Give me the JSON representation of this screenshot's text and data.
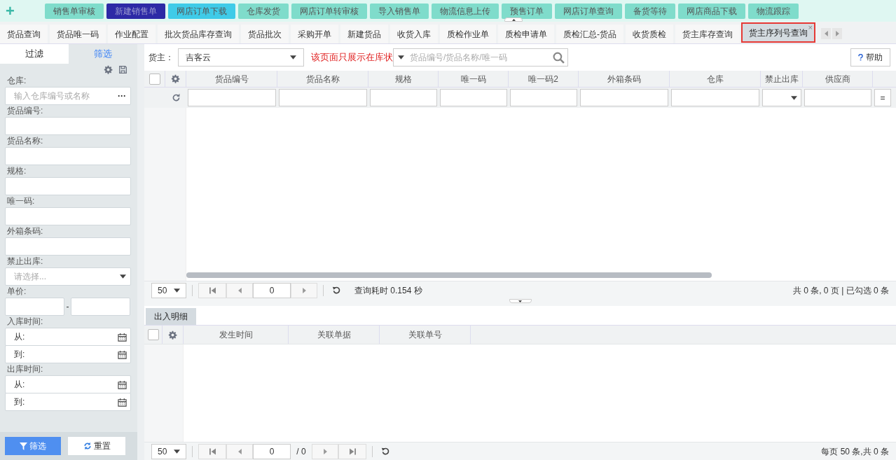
{
  "toolbar": {
    "add_icon": "+",
    "buttons": [
      {
        "label": "销售单审核",
        "color": "#7fdccb"
      },
      {
        "label": "新建销售单",
        "color": "#2d2aa6"
      },
      {
        "label": "网店订单下载",
        "color": "#3fcbe8"
      },
      {
        "label": "仓库发货",
        "color": "#7fdccb"
      },
      {
        "label": "网店订单转审核",
        "color": "#7fdccb"
      },
      {
        "label": "导入销售单",
        "color": "#7fdccb"
      },
      {
        "label": "物流信息上传",
        "color": "#7fdccb"
      },
      {
        "label": "预售订单",
        "color": "#7fdccb"
      },
      {
        "label": "网店订单查询",
        "color": "#7fdccb"
      },
      {
        "label": "备货等待",
        "color": "#7fdccb"
      },
      {
        "label": "网店商品下载",
        "color": "#7fdccb"
      },
      {
        "label": "物流跟踪",
        "color": "#7fdccb"
      }
    ]
  },
  "tabs": [
    {
      "label": "货品查询",
      "selected": false
    },
    {
      "label": "货品唯一码",
      "selected": false
    },
    {
      "label": "作业配置",
      "selected": false
    },
    {
      "label": "批次货品库存查询",
      "selected": false
    },
    {
      "label": "货品批次",
      "selected": false
    },
    {
      "label": "采购开单",
      "selected": false
    },
    {
      "label": "新建货品",
      "selected": false
    },
    {
      "label": "收货入库",
      "selected": false
    },
    {
      "label": "质检作业单",
      "selected": false
    },
    {
      "label": "质检申请单",
      "selected": false
    },
    {
      "label": "质检汇总-货品",
      "selected": false
    },
    {
      "label": "收货质检",
      "selected": false
    },
    {
      "label": "货主库存查询",
      "selected": false
    },
    {
      "label": "货主序列号查询",
      "selected": true,
      "close": "×"
    }
  ],
  "sidebar": {
    "tabs": [
      {
        "label": "过滤",
        "selected": false
      },
      {
        "label": "筛选",
        "selected": true
      }
    ],
    "fields": [
      {
        "kind": "lookup",
        "label": "仓库:",
        "placeholder": "输入仓库编号或名称",
        "button": "···"
      },
      {
        "kind": "text",
        "label": "货品编号:"
      },
      {
        "kind": "text",
        "label": "货品名称:"
      },
      {
        "kind": "text",
        "label": "规格:"
      },
      {
        "kind": "text",
        "label": "唯一码:"
      },
      {
        "kind": "text",
        "label": "外箱条码:"
      },
      {
        "kind": "select",
        "label": "禁止出库:",
        "placeholder": "请选择..."
      },
      {
        "kind": "range",
        "label": "单价:",
        "separator": "-"
      },
      {
        "kind": "dates",
        "label": "入库时间:",
        "from": "从:",
        "to": "到:"
      },
      {
        "kind": "dates",
        "label": "出库时间:",
        "from": "从:",
        "to": "到:"
      }
    ],
    "filter_button": "筛选",
    "reset_button": "重置"
  },
  "main": {
    "owner_label": "货主：",
    "owner_value": "吉客云",
    "notice": "该页面只展示在库状",
    "search_placeholder": "货品编号/货品名称/唯一码",
    "help_button": "帮助",
    "columns": [
      {
        "label": "货品编号",
        "kind": "text"
      },
      {
        "label": "货品名称",
        "kind": "text"
      },
      {
        "label": "规格",
        "kind": "text"
      },
      {
        "label": "唯一码",
        "kind": "text"
      },
      {
        "label": "唯一码2",
        "kind": "text"
      },
      {
        "label": "外箱条码",
        "kind": "text"
      },
      {
        "label": "仓库",
        "kind": "text"
      },
      {
        "label": "禁止出库",
        "kind": "select"
      },
      {
        "label": "供应商",
        "kind": "text"
      }
    ],
    "header_checkbox": {
      "checked": false
    },
    "filter_equals": "=",
    "pager": {
      "page_size": "50",
      "page": "0",
      "timing": "查询耗时 0.154 秒",
      "summary": "共 0 条, 0 页 | 已勾选 0 条"
    }
  },
  "detail": {
    "tab": "出入明细",
    "header_checkbox": {
      "checked": false
    },
    "columns": [
      "发生时间",
      "关联单据",
      "关联单号"
    ],
    "pager": {
      "page_size": "50",
      "page": "0",
      "total_pages": "/ 0",
      "summary": "每页 50 条,共 0 条"
    }
  }
}
